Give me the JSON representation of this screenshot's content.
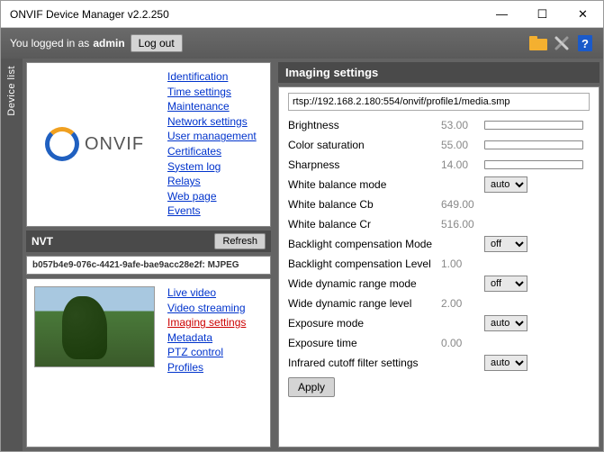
{
  "window": {
    "title": "ONVIF Device Manager v2.2.250"
  },
  "topbar": {
    "login_prefix": "You logged in as",
    "username": "admin",
    "logout_label": "Log out"
  },
  "sidebar_tab": {
    "label": "Device list"
  },
  "device_links": [
    "Identification",
    "Time settings",
    "Maintenance",
    "Network settings",
    "User management",
    "Certificates",
    "System log",
    "Relays",
    "Web page",
    "Events"
  ],
  "logo_text": "ONVIF",
  "nvt": {
    "title": "NVT",
    "refresh_label": "Refresh",
    "uuid": "b057b4e9-076c-4421-9afe-bae9acc28e2f: MJPEG"
  },
  "live_links": [
    {
      "label": "Live video",
      "active": false
    },
    {
      "label": "Video streaming",
      "active": false
    },
    {
      "label": "Imaging settings",
      "active": true
    },
    {
      "label": "Metadata",
      "active": false
    },
    {
      "label": "PTZ control",
      "active": false
    },
    {
      "label": "Profiles",
      "active": false
    }
  ],
  "imaging": {
    "header": "Imaging settings",
    "url": "rtsp://192.168.2.180:554/onvif/profile1/media.smp",
    "rows": [
      {
        "label": "Brightness",
        "value": "53.00",
        "control": "slider"
      },
      {
        "label": "Color saturation",
        "value": "55.00",
        "control": "slider"
      },
      {
        "label": "Sharpness",
        "value": "14.00",
        "control": "slider"
      },
      {
        "label": "White balance mode",
        "value": "",
        "control": "select",
        "option": "auto"
      },
      {
        "label": "White balance Cb",
        "value": "649.00",
        "control": "none"
      },
      {
        "label": "White balance Cr",
        "value": "516.00",
        "control": "none"
      },
      {
        "label": "Backlight compensation Mode",
        "value": "",
        "control": "select",
        "option": "off"
      },
      {
        "label": "Backlight compensation Level",
        "value": "1.00",
        "control": "none"
      },
      {
        "label": "Wide dynamic range mode",
        "value": "",
        "control": "select",
        "option": "off"
      },
      {
        "label": "Wide dynamic range level",
        "value": "2.00",
        "control": "none"
      },
      {
        "label": "Exposure mode",
        "value": "",
        "control": "select",
        "option": "auto"
      },
      {
        "label": "Exposure time",
        "value": "0.00",
        "control": "none"
      },
      {
        "label": "Infrared cutoff filter settings",
        "value": "",
        "control": "select",
        "option": "auto"
      }
    ],
    "apply_label": "Apply"
  }
}
